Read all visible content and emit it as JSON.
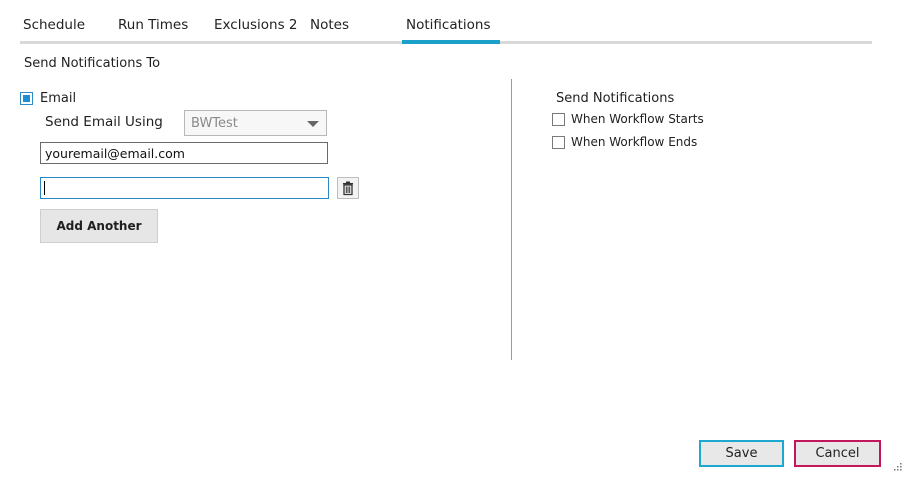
{
  "tabs": [
    {
      "label": "Schedule"
    },
    {
      "label": "Run Times"
    },
    {
      "label": "Exclusions 2"
    },
    {
      "label": "Notes"
    },
    {
      "label": "Notifications",
      "active": true
    }
  ],
  "section_title": "Send Notifications To",
  "email": {
    "checkbox_label": "Email",
    "checked": true,
    "send_using_label": "Send Email Using",
    "send_using_value": "BWTest",
    "addresses": [
      "youremail@email.com",
      ""
    ],
    "add_another_label": "Add Another"
  },
  "notifications": {
    "title": "Send Notifications",
    "options": [
      {
        "label": "When Workflow Starts",
        "checked": false
      },
      {
        "label": "When Workflow Ends",
        "checked": false
      }
    ]
  },
  "footer": {
    "save_label": "Save",
    "cancel_label": "Cancel"
  },
  "colors": {
    "accent": "#1ba1c9",
    "cancel_border": "#c2185b",
    "checkbox_fill": "#1d8ed1"
  },
  "icons": {
    "delete": "trash-icon",
    "dropdown": "chevron-down-icon",
    "resize": "resize-grip-icon"
  }
}
